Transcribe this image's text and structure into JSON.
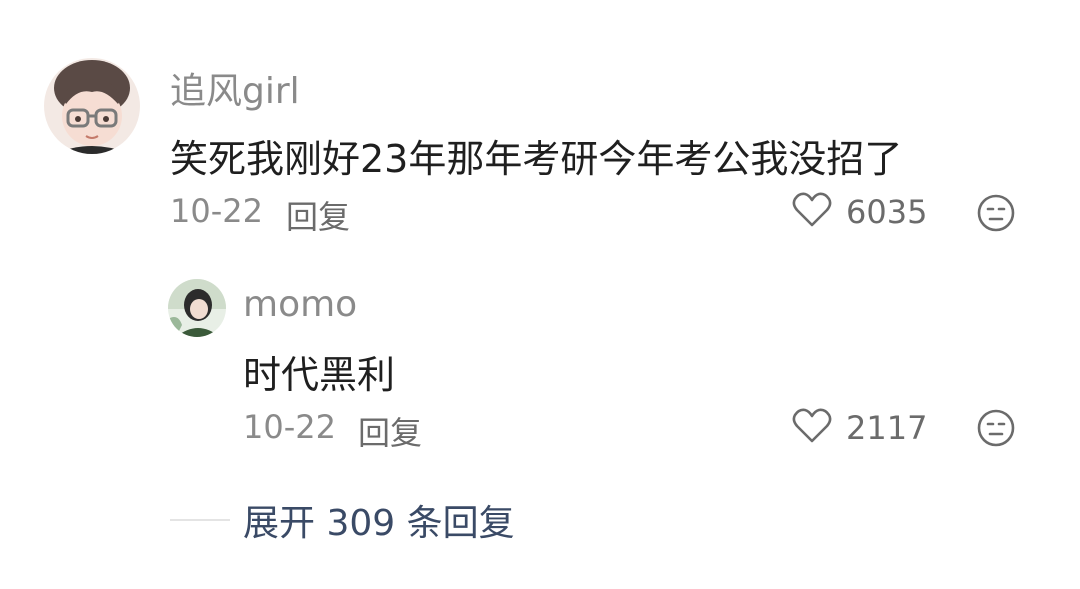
{
  "comment": {
    "username": "追风girl",
    "text": "笑死我刚好23年那年考研今年考公我没招了",
    "date": "10-22",
    "reply_label": "回复",
    "like_count": "6035"
  },
  "reply": {
    "username": "momo",
    "text": "时代黑利",
    "date": "10-22",
    "reply_label": "回复",
    "like_count": "2117"
  },
  "expand_label": "展开 309 条回复",
  "colors": {
    "username": "#8a8a8a",
    "text": "#1f1f1f",
    "expand": "#3a4a66"
  }
}
